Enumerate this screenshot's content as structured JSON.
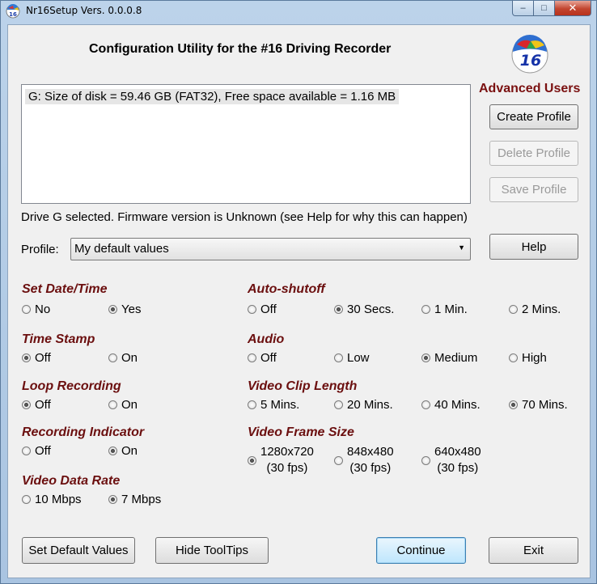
{
  "window": {
    "title": "Nr16Setup  Vers. 0.0.0.8",
    "controls": {
      "minimize": "–",
      "maximize": "□",
      "close": "✕"
    }
  },
  "heading": "Configuration Utility for the #16 Driving Recorder",
  "logo_text": "16",
  "advanced_users": {
    "label": "Advanced Users",
    "create_profile": "Create Profile",
    "delete_profile": "Delete Profile",
    "save_profile": "Save Profile"
  },
  "drives": [
    "G:  Size of disk = 59.46 GB (FAT32), Free space available = 1.16 MB"
  ],
  "status": "Drive G selected. Firmware version is Unknown (see Help for why this can happen)",
  "profile": {
    "label": "Profile:",
    "selected": "My default values"
  },
  "help_label": "Help",
  "groups": {
    "set_datetime": {
      "title": "Set Date/Time",
      "options": [
        "No",
        "Yes"
      ],
      "selected": 1
    },
    "time_stamp": {
      "title": "Time Stamp",
      "options": [
        "Off",
        "On"
      ],
      "selected": 0
    },
    "loop_recording": {
      "title": "Loop Recording",
      "options": [
        "Off",
        "On"
      ],
      "selected": 0
    },
    "recording_indicator": {
      "title": "Recording Indicator",
      "options": [
        "Off",
        "On"
      ],
      "selected": 1
    },
    "video_data_rate": {
      "title": "Video Data Rate",
      "options": [
        "10 Mbps",
        "7 Mbps"
      ],
      "selected": 1
    },
    "auto_shutoff": {
      "title": "Auto-shutoff",
      "options": [
        "Off",
        "30 Secs.",
        "1 Min.",
        "2 Mins."
      ],
      "selected": 1
    },
    "audio": {
      "title": "Audio",
      "options": [
        "Off",
        "Low",
        "Medium",
        "High"
      ],
      "selected": 2
    },
    "video_clip_length": {
      "title": "Video Clip Length",
      "options": [
        "5 Mins.",
        "20 Mins.",
        "40 Mins.",
        "70 Mins."
      ],
      "selected": 3
    },
    "video_frame_size": {
      "title": "Video Frame Size",
      "options": [
        {
          "res": "1280x720",
          "fps": "(30 fps)"
        },
        {
          "res": "848x480",
          "fps": "(30 fps)"
        },
        {
          "res": "640x480",
          "fps": "(30 fps)"
        }
      ],
      "selected": 0
    }
  },
  "bottom_buttons": {
    "set_default": "Set Default Values",
    "hide_tooltips": "Hide ToolTips",
    "continue": "Continue",
    "exit": "Exit"
  }
}
